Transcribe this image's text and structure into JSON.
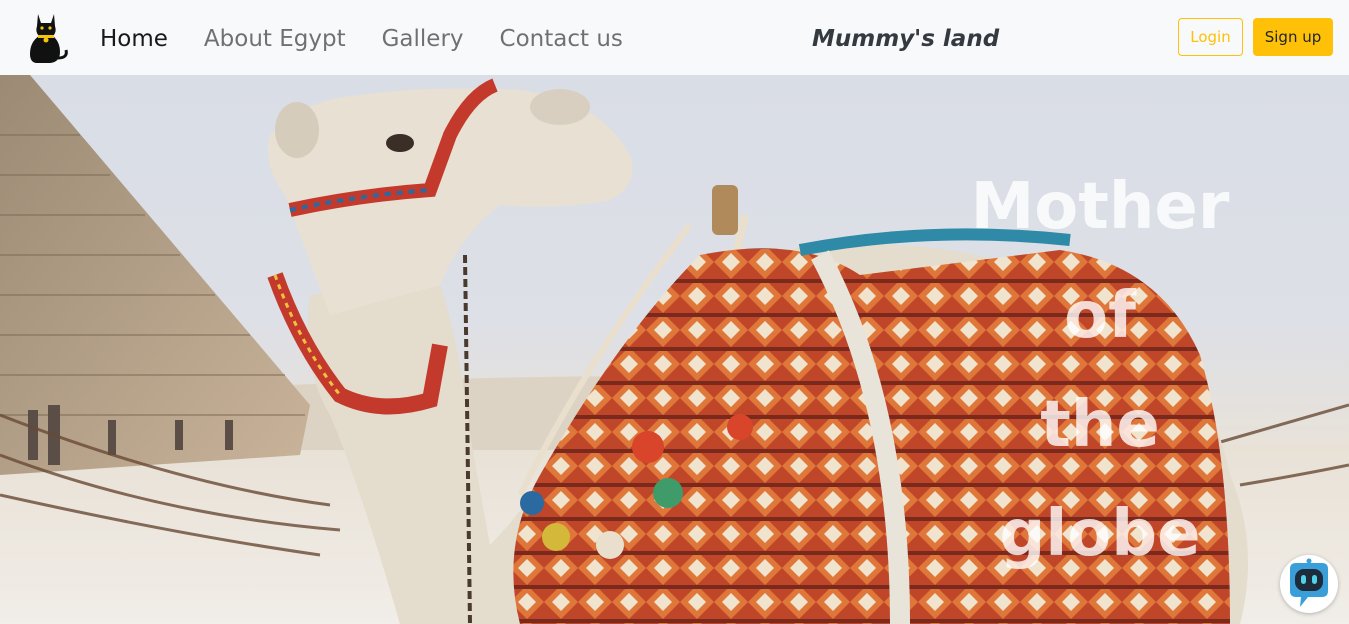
{
  "nav": {
    "links": [
      {
        "label": "Home",
        "active": true
      },
      {
        "label": "About Egypt",
        "active": false
      },
      {
        "label": "Gallery",
        "active": false
      },
      {
        "label": "Contact us",
        "active": false
      }
    ],
    "brand": "Mummy's land",
    "login_label": "Login",
    "signup_label": "Sign up",
    "logo_icon": "black-cat-logo-icon"
  },
  "hero": {
    "lines": [
      "Mother",
      "of",
      "the",
      "globe"
    ],
    "image": "camel-pyramid-photo"
  },
  "chatbot": {
    "icon": "robot-chat-icon"
  },
  "colors": {
    "accent": "#ffc107",
    "navbar_bg": "#f8f9fa",
    "brand_text": "#343a40"
  }
}
